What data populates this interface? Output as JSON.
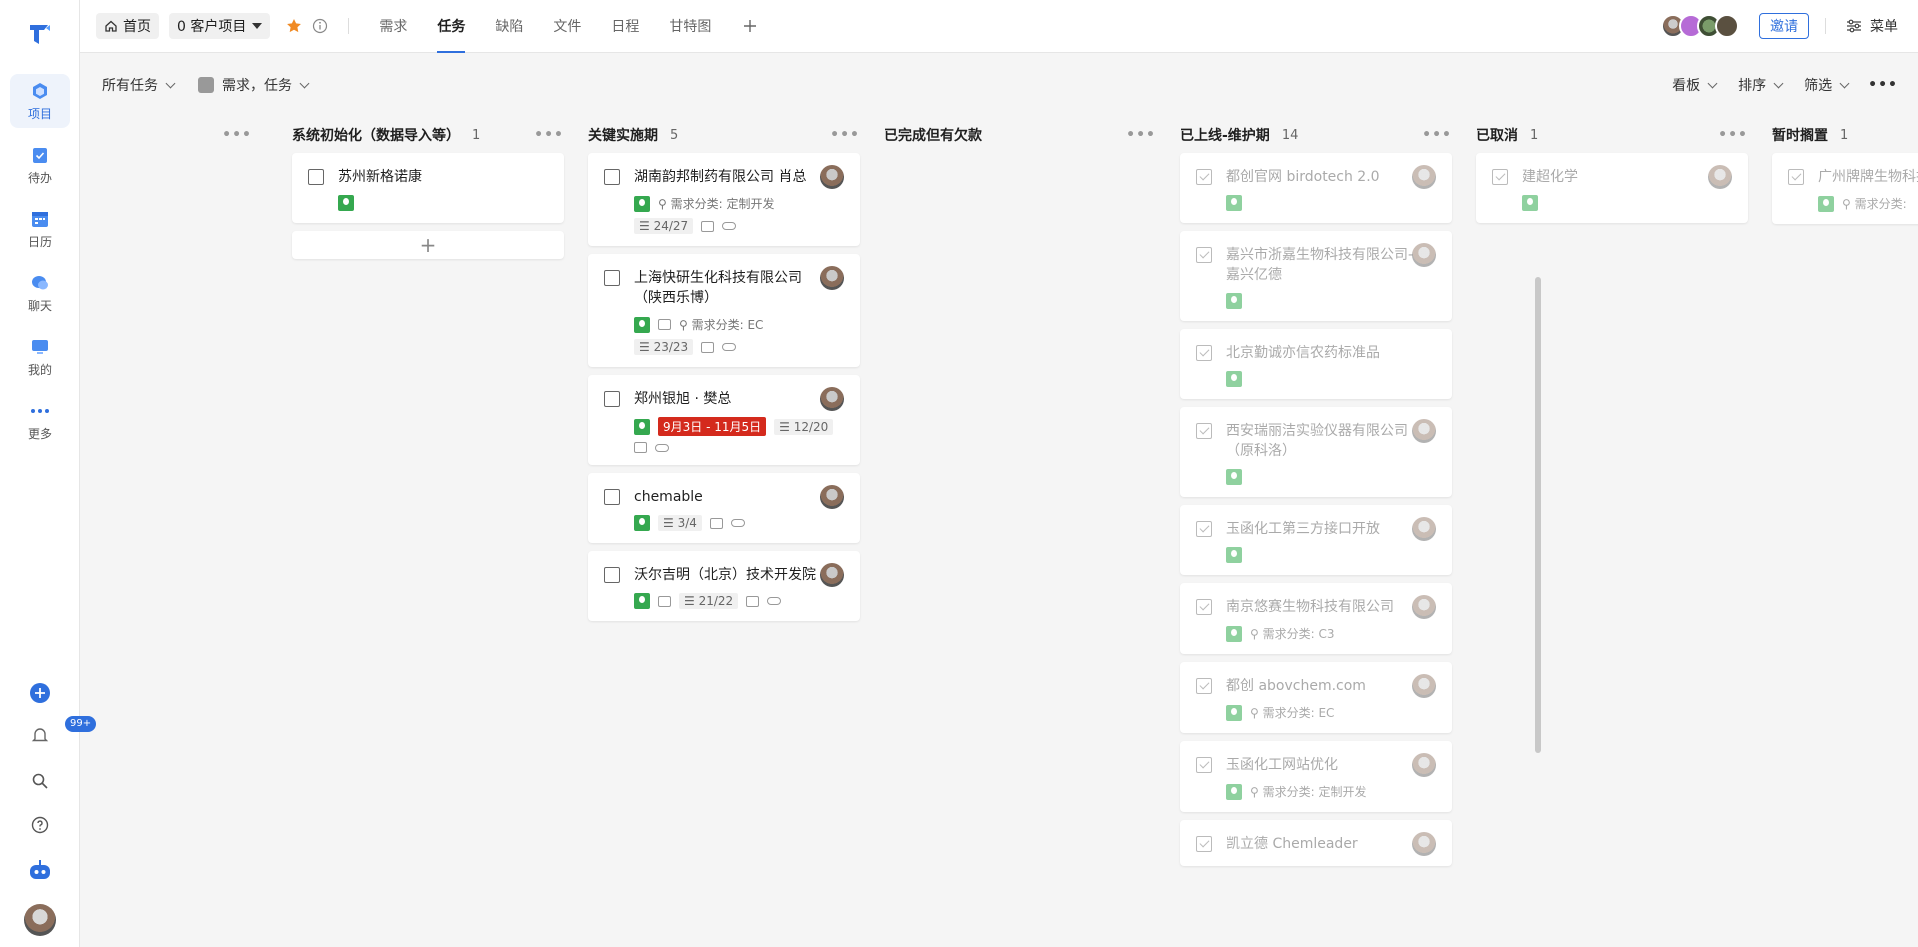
{
  "sidebar": {
    "items": [
      {
        "label": "项目",
        "icon": "project-icon",
        "active": true
      },
      {
        "label": "待办",
        "icon": "todo-icon"
      },
      {
        "label": "日历",
        "icon": "calendar-icon"
      },
      {
        "label": "聊天",
        "icon": "chat-icon"
      },
      {
        "label": "我的",
        "icon": "me-icon"
      },
      {
        "label": "更多",
        "icon": "more-icon"
      }
    ],
    "notification_badge": "99+"
  },
  "topbar": {
    "home_label": "首页",
    "project_label": "0 客户项目",
    "tabs": [
      "需求",
      "任务",
      "缺陷",
      "文件",
      "日程",
      "甘特图"
    ],
    "active_tab": "任务",
    "invite_label": "邀请",
    "menu_label": "菜单"
  },
  "toolbar": {
    "scope_label": "所有任务",
    "type_label": "需求，任务",
    "view_label": "看板",
    "sort_label": "排序",
    "filter_label": "筛选"
  },
  "columns": [
    {
      "title": "系统初始化（数据导入等）",
      "count": "1",
      "cards": [
        {
          "title": "苏州新格诺康"
        }
      ]
    },
    {
      "title": "关键实施期",
      "count": "5",
      "cards": [
        {
          "title": "湖南韵邦制药有限公司 肖总",
          "category": "需求分类: 定制开发",
          "progress": "24/27"
        },
        {
          "title": "上海快研生化科技有限公司（陕西乐博）",
          "category": "需求分类: EC",
          "progress": "23/23"
        },
        {
          "title": "郑州银旭 · 樊总",
          "date_range": "9月3日 - 11月5日",
          "progress": "12/20"
        },
        {
          "title": "chemable",
          "progress": "3/4"
        },
        {
          "title": "沃尔吉明（北京）技术开发院",
          "progress": "21/22"
        }
      ]
    },
    {
      "title": "已完成但有欠款",
      "count": "",
      "cards": []
    },
    {
      "title": "已上线-维护期",
      "count": "14",
      "cards": [
        {
          "title": "都创官网 birdotech 2.0"
        },
        {
          "title": "嘉兴市浙嘉生物科技有限公司-嘉兴亿德"
        },
        {
          "title": "北京勤诚亦信农药标准品"
        },
        {
          "title": "西安瑞丽洁实验仪器有限公司（原科洛）"
        },
        {
          "title": "玉函化工第三方接口开放"
        },
        {
          "title": "南京悠赛生物科技有限公司",
          "category": "需求分类: C3"
        },
        {
          "title": "都创 abovchem.com",
          "category": "需求分类: EC"
        },
        {
          "title": "玉函化工网站优化",
          "category": "需求分类: 定制开发"
        },
        {
          "title": "凯立德 Chemleader"
        }
      ]
    },
    {
      "title": "已取消",
      "count": "1",
      "cards": [
        {
          "title": "建超化学"
        }
      ]
    },
    {
      "title": "暂时搁置",
      "count": "1",
      "cards": [
        {
          "title": "广州牌牌生物科技",
          "category": "需求分类: "
        }
      ]
    }
  ]
}
